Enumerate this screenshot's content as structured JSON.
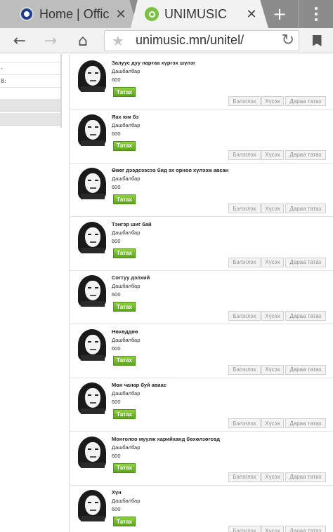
{
  "browser": {
    "tabs": [
      {
        "title": "Home | Offic…",
        "close": "✕"
      },
      {
        "title": "UNIMUSIC",
        "close": "✕"
      }
    ],
    "new_tab": "+",
    "url": "unimusic.mn/unitel/"
  },
  "left_panel": {
    "rows": [
      "",
      "-",
      "8:"
    ]
  },
  "songs": [
    {
      "title": "Залуус дуу нартаа хүргэх шүлэг",
      "artist": "Дашбалбар",
      "price": "600",
      "download": "Татах"
    },
    {
      "title": "Яах юм бэ",
      "artist": "Дашбалбар",
      "price": "600",
      "download": "Татах"
    },
    {
      "title": "Өвөг дээдсээсээ бид эх орноо хүлээж авсан",
      "artist": "Дашбалбар",
      "price": "600",
      "download": "Татах"
    },
    {
      "title": "Тэнгэр шиг бай",
      "artist": "Дашбалбар",
      "price": "600",
      "download": "Татах"
    },
    {
      "title": "Согтуу дэлхий",
      "artist": "Дашбалбар",
      "price": "600",
      "download": "Татах"
    },
    {
      "title": "Нөхөддөө",
      "artist": "Дашбалбар",
      "price": "600",
      "download": "Татах"
    },
    {
      "title": "Мөн чанар буй аваас",
      "artist": "Дашбалбар",
      "price": "600",
      "download": "Татах"
    },
    {
      "title": "Монголоо муулж харийханд бөхөлзөгсөд",
      "artist": "Дашбалбар",
      "price": "600",
      "download": "Татах"
    },
    {
      "title": "Хүн",
      "artist": "Дашбалбар",
      "price": "600",
      "download": "Татах"
    }
  ],
  "actions": {
    "gift": "Бэлэглэх",
    "wish": "Хүсэх",
    "next": "Дараа татах"
  }
}
